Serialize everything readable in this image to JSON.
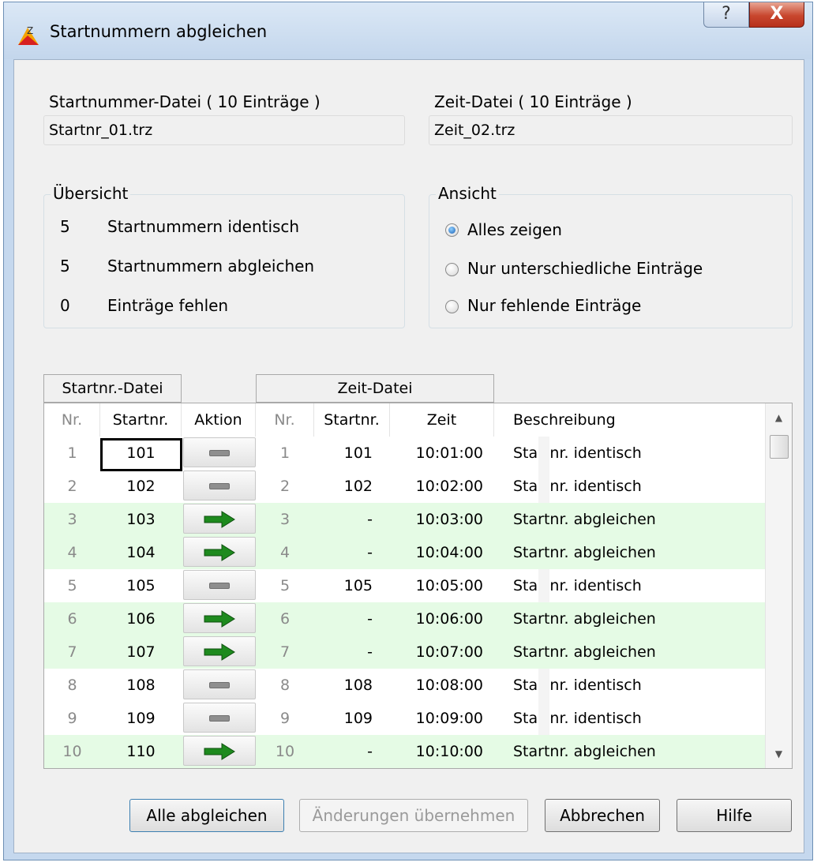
{
  "window": {
    "title": "Startnummern abgleichen",
    "help_glyph": "?",
    "close_glyph": "X"
  },
  "files": {
    "startnr": {
      "label": "Startnummer-Datei ( 10 Einträge )",
      "value": "Startnr_01.trz"
    },
    "zeit": {
      "label": "Zeit-Datei ( 10 Einträge )",
      "value": "Zeit_02.trz"
    }
  },
  "overview": {
    "title": "Übersicht",
    "items": [
      {
        "count": "5",
        "text": "Startnummern identisch"
      },
      {
        "count": "5",
        "text": "Startnummern abgleichen"
      },
      {
        "count": "0",
        "text": "Einträge fehlen"
      }
    ]
  },
  "view": {
    "title": "Ansicht",
    "options": [
      {
        "label": "Alles zeigen",
        "checked": true
      },
      {
        "label": "Nur unterschiedliche Einträge",
        "checked": false
      },
      {
        "label": "Nur fehlende Einträge",
        "checked": false
      }
    ]
  },
  "grid": {
    "group_startnr": "Startnr.-Datei",
    "group_zeit": "Zeit-Datei",
    "columns": [
      "Nr.",
      "Startnr.",
      "Aktion",
      "Nr.",
      "Startnr.",
      "Zeit",
      "Beschreibung"
    ],
    "rows": [
      {
        "nr": "1",
        "startnr": "101",
        "action": "equal",
        "nr2": "1",
        "startnr2": "101",
        "zeit": "10:01:00",
        "desc": "Startnr. identisch"
      },
      {
        "nr": "2",
        "startnr": "102",
        "action": "equal",
        "nr2": "2",
        "startnr2": "102",
        "zeit": "10:02:00",
        "desc": "Startnr. identisch"
      },
      {
        "nr": "3",
        "startnr": "103",
        "action": "arrow",
        "nr2": "3",
        "startnr2": "-",
        "zeit": "10:03:00",
        "desc": "Startnr. abgleichen"
      },
      {
        "nr": "4",
        "startnr": "104",
        "action": "arrow",
        "nr2": "4",
        "startnr2": "-",
        "zeit": "10:04:00",
        "desc": "Startnr. abgleichen"
      },
      {
        "nr": "5",
        "startnr": "105",
        "action": "equal",
        "nr2": "5",
        "startnr2": "105",
        "zeit": "10:05:00",
        "desc": "Startnr. identisch"
      },
      {
        "nr": "6",
        "startnr": "106",
        "action": "arrow",
        "nr2": "6",
        "startnr2": "-",
        "zeit": "10:06:00",
        "desc": "Startnr. abgleichen"
      },
      {
        "nr": "7",
        "startnr": "107",
        "action": "arrow",
        "nr2": "7",
        "startnr2": "-",
        "zeit": "10:07:00",
        "desc": "Startnr. abgleichen"
      },
      {
        "nr": "8",
        "startnr": "108",
        "action": "equal",
        "nr2": "8",
        "startnr2": "108",
        "zeit": "10:08:00",
        "desc": "Startnr. identisch"
      },
      {
        "nr": "9",
        "startnr": "109",
        "action": "equal",
        "nr2": "9",
        "startnr2": "109",
        "zeit": "10:09:00",
        "desc": "Startnr. identisch"
      },
      {
        "nr": "10",
        "startnr": "110",
        "action": "arrow",
        "nr2": "10",
        "startnr2": "-",
        "zeit": "10:10:00",
        "desc": "Startnr. abgleichen"
      }
    ]
  },
  "buttons": {
    "alle": "Alle abgleichen",
    "uebernehmen": "Änderungen übernehmen",
    "abbrechen": "Abbrechen",
    "hilfe": "Hilfe"
  },
  "colors": {
    "highlight_row": "#e5fbe5",
    "arrow": "#1e8a1e",
    "title_bar": "#c5d8ee"
  }
}
